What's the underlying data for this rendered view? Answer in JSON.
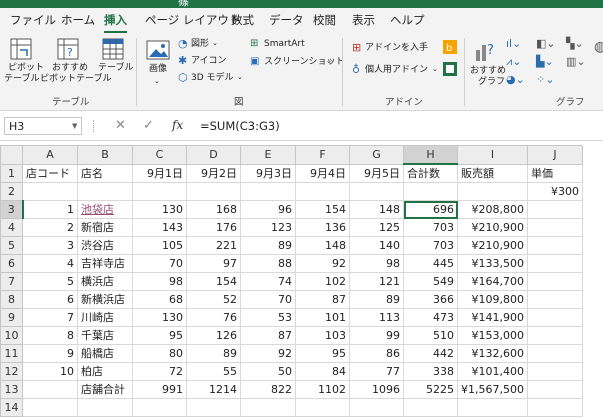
{
  "titlebar": {
    "fragment": "篠"
  },
  "tabs": [
    "ファイル",
    "ホーム",
    "挿入",
    "ページ レイアウト",
    "数式",
    "データ",
    "校閲",
    "表示",
    "ヘルプ"
  ],
  "active_tab": "挿入",
  "ribbon": {
    "pivot_line1": "ピボット",
    "pivot_line2": "テーブル",
    "rec_pivot_line1": "おすすめ",
    "rec_pivot_line2": "ピボットテーブル",
    "table": "テーブル",
    "group_table": "テーブル",
    "image": "画像",
    "shapes": "図形",
    "icons": "アイコン",
    "models3d": "3D モデル",
    "smartart": "SmartArt",
    "screenshot": "スクリーンショット",
    "group_figure": "図",
    "get_addins": "アドインを入手",
    "my_addins": "個人用アドイン",
    "group_addins": "アドイン",
    "rec_charts_line1": "おすすめ",
    "rec_charts_line2": "グラフ",
    "group_charts": "グラフ"
  },
  "formula_bar": {
    "name_box": "H3",
    "fx": "fx",
    "formula": "=SUM(C3:G3)"
  },
  "columns": [
    "A",
    "B",
    "C",
    "D",
    "E",
    "F",
    "G",
    "H",
    "I",
    "J"
  ],
  "rows": [
    {
      "n": "1",
      "cells": [
        "店コード",
        "店名",
        "9月1日",
        "9月2日",
        "9月3日",
        "9月4日",
        "9月5日",
        "合計数",
        "販売額",
        "単価"
      ]
    },
    {
      "n": "2",
      "cells": [
        "",
        "",
        "",
        "",
        "",
        "",
        "",
        "",
        "",
        "¥300"
      ]
    },
    {
      "n": "3",
      "cells": [
        "1",
        "池袋店",
        "130",
        "168",
        "96",
        "154",
        "148",
        "696",
        "¥208,800",
        ""
      ]
    },
    {
      "n": "4",
      "cells": [
        "2",
        "新宿店",
        "143",
        "176",
        "123",
        "136",
        "125",
        "703",
        "¥210,900",
        ""
      ]
    },
    {
      "n": "5",
      "cells": [
        "3",
        "渋谷店",
        "105",
        "221",
        "89",
        "148",
        "140",
        "703",
        "¥210,900",
        ""
      ]
    },
    {
      "n": "6",
      "cells": [
        "4",
        "吉祥寺店",
        "70",
        "97",
        "88",
        "92",
        "98",
        "445",
        "¥133,500",
        ""
      ]
    },
    {
      "n": "7",
      "cells": [
        "5",
        "横浜店",
        "98",
        "154",
        "74",
        "102",
        "121",
        "549",
        "¥164,700",
        ""
      ]
    },
    {
      "n": "8",
      "cells": [
        "6",
        "新横浜店",
        "68",
        "52",
        "70",
        "87",
        "89",
        "366",
        "¥109,800",
        ""
      ]
    },
    {
      "n": "9",
      "cells": [
        "7",
        "川崎店",
        "130",
        "76",
        "53",
        "101",
        "113",
        "473",
        "¥141,900",
        ""
      ]
    },
    {
      "n": "10",
      "cells": [
        "8",
        "千葉店",
        "95",
        "126",
        "87",
        "103",
        "99",
        "510",
        "¥153,000",
        ""
      ]
    },
    {
      "n": "11",
      "cells": [
        "9",
        "船橋店",
        "80",
        "89",
        "92",
        "95",
        "86",
        "442",
        "¥132,600",
        ""
      ]
    },
    {
      "n": "12",
      "cells": [
        "10",
        "柏店",
        "72",
        "55",
        "50",
        "84",
        "77",
        "338",
        "¥101,400",
        ""
      ]
    },
    {
      "n": "13",
      "cells": [
        "",
        "店舗合計",
        "991",
        "1214",
        "822",
        "1102",
        "1096",
        "5225",
        "¥1,567,500",
        ""
      ]
    },
    {
      "n": "14",
      "cells": [
        "",
        "",
        "",
        "",
        "",
        "",
        "",
        "",
        "",
        ""
      ]
    }
  ],
  "accent_color": "#217346"
}
